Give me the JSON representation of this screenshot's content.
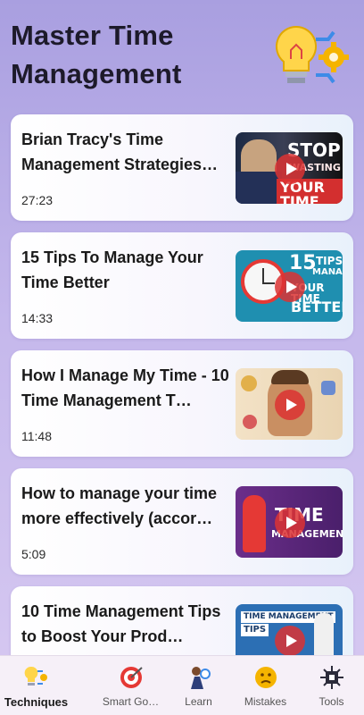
{
  "header": {
    "title": "Master Time Management",
    "icon": "lightbulb-gear-icon"
  },
  "videos": [
    {
      "title": "Brian Tracy's Time Management Strategies…",
      "duration": "27:23",
      "thumbnail_text": [
        "STOP",
        "WASTING",
        "YOUR TIME"
      ]
    },
    {
      "title": "15 Tips To Manage Your Time Better",
      "duration": "14:33",
      "thumbnail_text": [
        "15",
        "TIPS",
        "MANAGE",
        "YOUR TIME",
        "BETTER"
      ]
    },
    {
      "title": "How I Manage My Time - 10 Time Management T…",
      "duration": "11:48",
      "thumbnail_text": []
    },
    {
      "title": "How to manage your time more effectively (accor…",
      "duration": "5:09",
      "thumbnail_text": [
        "TIME",
        "MANAGEMENT"
      ]
    },
    {
      "title": "10 Time Management Tips to Boost Your Prod…",
      "duration": "",
      "thumbnail_text": [
        "TIME MANAGEMENT",
        "TIPS"
      ]
    }
  ],
  "nav": {
    "items": [
      {
        "label": "Techniques",
        "icon": "techniques-icon",
        "active": true
      },
      {
        "label": "Smart Go…",
        "icon": "target-icon",
        "active": false
      },
      {
        "label": "Learn",
        "icon": "learn-icon",
        "active": false
      },
      {
        "label": "Mistakes",
        "icon": "mistakes-icon",
        "active": false
      },
      {
        "label": "Tools",
        "icon": "tools-icon",
        "active": false
      }
    ]
  },
  "colors": {
    "accent_red": "#e53935",
    "nav_bg": "#f6f0f8",
    "bg_top": "#a99fe0"
  }
}
